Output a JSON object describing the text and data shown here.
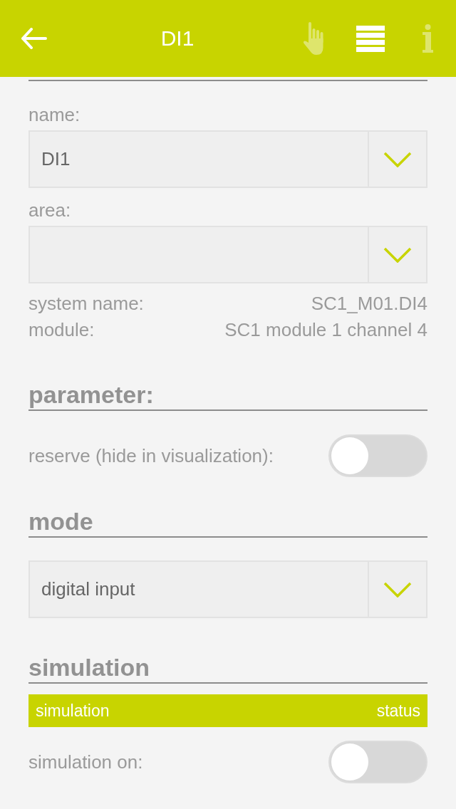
{
  "header": {
    "title": "DI1",
    "actions": [
      {
        "kind": "hand",
        "disabled": true
      },
      {
        "kind": "list",
        "disabled": false
      },
      {
        "kind": "info",
        "disabled": true
      }
    ]
  },
  "sections": [
    {
      "items": [
        {
          "kind": "dropdown",
          "label": "name:",
          "value": "DI1"
        },
        {
          "kind": "dropdown",
          "label": "area:"
        },
        {
          "kind": "info",
          "label": "system name:",
          "value": "SC1_M01.DI4"
        },
        {
          "kind": "info",
          "label": "module:",
          "value": "SC1 module 1 channel 4"
        }
      ]
    },
    {
      "title": "parameter:",
      "items": [
        {
          "kind": "toggle",
          "label": "reserve (hide in visualization):",
          "on": false
        }
      ]
    },
    {
      "title": "mode",
      "items": [
        {
          "kind": "dropdown",
          "value": "digital input"
        }
      ]
    },
    {
      "title": "simulation",
      "items": [
        {
          "kind": "table_header",
          "columns": [
            "simulation",
            "status"
          ]
        },
        {
          "kind": "toggle",
          "label": "simulation on:",
          "on": false
        }
      ]
    }
  ]
}
